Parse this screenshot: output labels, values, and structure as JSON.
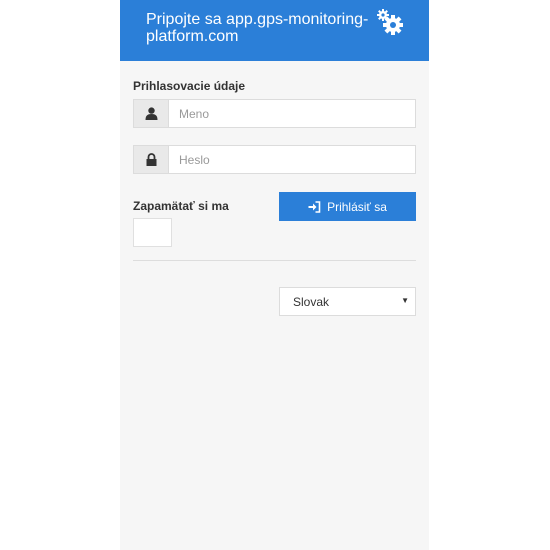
{
  "header": {
    "title": "Pripojte sa app.gps-monitoring-platform.com",
    "icon": "gears-icon",
    "background": "#2b7fd8"
  },
  "form": {
    "section_label": "Prihlasovacie údaje",
    "username": {
      "placeholder": "Meno",
      "value": "",
      "icon": "user-icon"
    },
    "password": {
      "placeholder": "Heslo",
      "value": "",
      "icon": "lock-icon"
    },
    "remember_label": "Zapamätať si ma",
    "login_label": "Prihlásiť sa",
    "login_icon": "sign-in-icon"
  },
  "language": {
    "selected": "Slovak"
  }
}
